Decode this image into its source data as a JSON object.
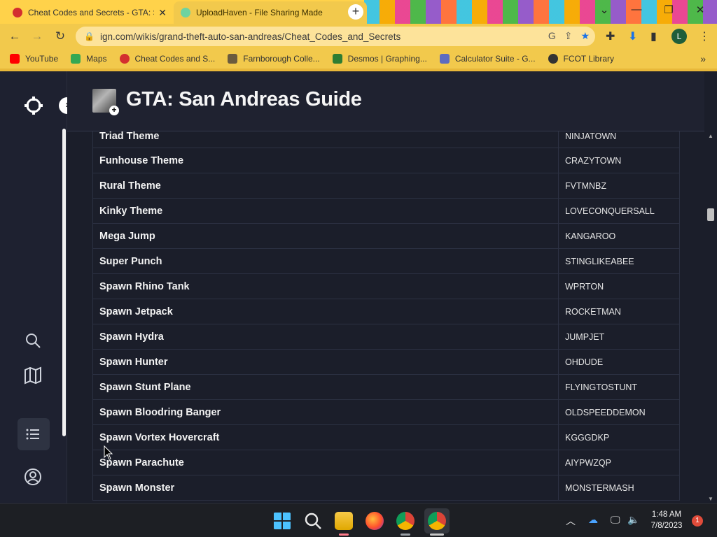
{
  "browser": {
    "tabs": [
      {
        "title": "Cheat Codes and Secrets - GTA: S",
        "active": false
      },
      {
        "title": "UploadHaven - File Sharing Made",
        "active": true
      }
    ],
    "url": "ign.com/wikis/grand-theft-auto-san-andreas/Cheat_Codes_and_Secrets",
    "bookmarks": [
      {
        "label": "YouTube",
        "color": "#ff0000"
      },
      {
        "label": "Maps",
        "color": "#34a853"
      },
      {
        "label": "Cheat Codes and S...",
        "color": "#d32f2f"
      },
      {
        "label": "Farnborough Colle...",
        "color": "#6b5b3e"
      },
      {
        "label": "Desmos | Graphing...",
        "color": "#2e7d32"
      },
      {
        "label": "Calculator Suite - G...",
        "color": "#5c6bc0"
      },
      {
        "label": "FCOT Library",
        "color": "#333333"
      }
    ],
    "profile_initial": "L",
    "accent_color": "#f2c94c"
  },
  "page": {
    "title": "GTA: San Andreas Guide",
    "cheats": [
      {
        "name": "Triad Theme",
        "code": "NINJATOWN"
      },
      {
        "name": "Funhouse Theme",
        "code": "CRAZYTOWN"
      },
      {
        "name": "Rural Theme",
        "code": "FVTMNBZ"
      },
      {
        "name": "Kinky Theme",
        "code": "LOVECONQUERSALL"
      },
      {
        "name": "Mega Jump",
        "code": "KANGAROO"
      },
      {
        "name": "Super Punch",
        "code": "STINGLIKEABEE"
      },
      {
        "name": "Spawn Rhino Tank",
        "code": "WPRTON"
      },
      {
        "name": "Spawn Jetpack",
        "code": "ROCKETMAN"
      },
      {
        "name": "Spawn Hydra",
        "code": "JUMPJET"
      },
      {
        "name": "Spawn Hunter",
        "code": "OHDUDE"
      },
      {
        "name": "Spawn Stunt Plane",
        "code": "FLYINGTOSTUNT"
      },
      {
        "name": "Spawn Bloodring Banger",
        "code": "OLDSPEEDDEMON"
      },
      {
        "name": "Spawn Vortex Hovercraft",
        "code": "KGGGDKP"
      },
      {
        "name": "Spawn Parachute",
        "code": "AIYPWZQP"
      },
      {
        "name": "Spawn Monster",
        "code": "MONSTERMASH"
      }
    ]
  },
  "taskbar": {
    "time": "1:48 AM",
    "date": "7/8/2023",
    "notification_count": "1"
  }
}
